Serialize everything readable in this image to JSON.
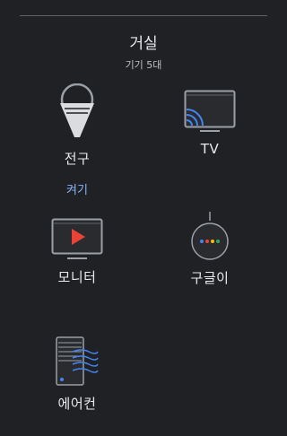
{
  "room": {
    "title": "거실",
    "subtitle": "기기 5대"
  },
  "devices": [
    {
      "label": "전구",
      "icon": "light-bulb-icon",
      "action": "켜기"
    },
    {
      "label": "TV",
      "icon": "cast-tv-icon"
    },
    {
      "label": "모니터",
      "icon": "monitor-play-icon"
    },
    {
      "label": "구글이",
      "icon": "google-home-mini-icon"
    },
    {
      "label": "에어컨",
      "icon": "air-conditioner-icon"
    }
  ],
  "colors": {
    "background": "#202124",
    "text": "#e8eaed",
    "subtext": "#bdc1c6",
    "accent": "#8ab4f8",
    "play": "#ea4335"
  }
}
